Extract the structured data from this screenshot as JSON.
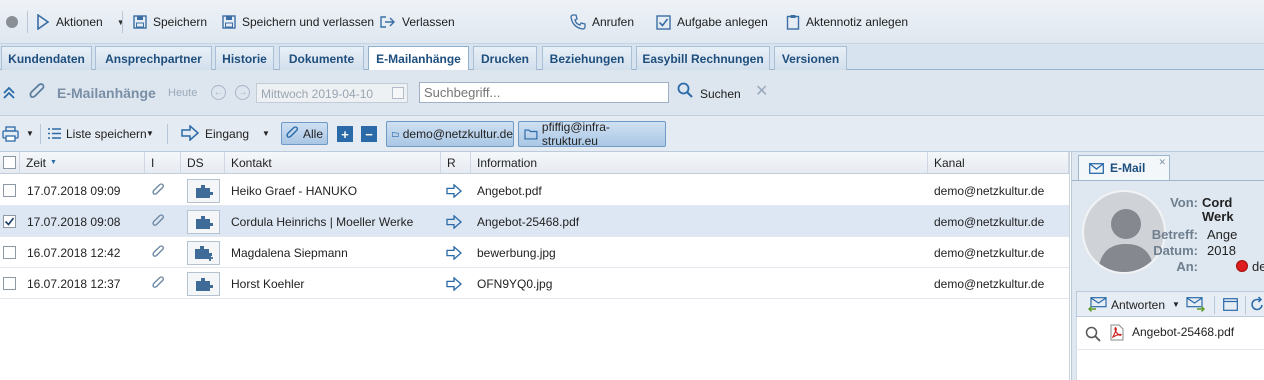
{
  "toolbar": {
    "actions_label": "Aktionen",
    "save_label": "Speichern",
    "save_close_label": "Speichern und verlassen",
    "leave_label": "Verlassen",
    "call_label": "Anrufen",
    "task_label": "Aufgabe anlegen",
    "note_label": "Aktennotiz anlegen"
  },
  "tabs": [
    {
      "label": "Kundendaten"
    },
    {
      "label": "Ansprechpartner"
    },
    {
      "label": "Historie"
    },
    {
      "label": "Dokumente"
    },
    {
      "label": "E-Mailanhänge",
      "active": true
    },
    {
      "label": "Drucken"
    },
    {
      "label": "Beziehungen"
    },
    {
      "label": "Easybill Rechnungen"
    },
    {
      "label": "Versionen"
    }
  ],
  "filter": {
    "title": "E-Mailanhänge",
    "today_label": "Heute",
    "date_value": "Mittwoch 2019-04-10",
    "search_placeholder": "Suchbegriff...",
    "search_label": "Suchen"
  },
  "listbar": {
    "save_list_label": "Liste speichern",
    "inbox_label": "Eingang",
    "all_label": "Alle",
    "mailbox_1": "demo@netzkultur.de",
    "mailbox_2": "pfiffig@infra-struktur.eu"
  },
  "grid": {
    "columns": {
      "zeit": "Zeit",
      "i": "I",
      "ds": "DS",
      "kontakt": "Kontakt",
      "r": "R",
      "information": "Information",
      "kanal": "Kanal"
    },
    "rows": [
      {
        "zeit": "17.07.2018 09:09",
        "kontakt": "Heiko Graef - HANUKO",
        "information": "Angebot.pdf",
        "kanal": "demo@netzkultur.de",
        "checked": false,
        "selected": false
      },
      {
        "zeit": "17.07.2018 09:08",
        "kontakt": "Cordula Heinrichs | Moeller Werke",
        "information": "Angebot-25468.pdf",
        "kanal": "demo@netzkultur.de",
        "checked": true,
        "selected": true
      },
      {
        "zeit": "16.07.2018 12:42",
        "kontakt": "Magdalena Siepmann",
        "information": "bewerbung.jpg",
        "kanal": "demo@netzkultur.de",
        "checked": false,
        "selected": false
      },
      {
        "zeit": "16.07.2018 12:37",
        "kontakt": "Horst Koehler",
        "information": "OFN9YQ0.jpg",
        "kanal": "demo@netzkultur.de",
        "checked": false,
        "selected": false
      }
    ]
  },
  "email_panel": {
    "tab_label": "E-Mail",
    "von_label": "Von:",
    "von_value_1": "Cord",
    "von_value_2": "Werk",
    "betreff_label": "Betreff:",
    "betreff_value": "Ange",
    "datum_label": "Datum:",
    "datum_value": "2018",
    "an_label": "An:",
    "an_value": "de",
    "reply_label": "Antworten",
    "attachment_name": "Angebot-25468.pdf"
  },
  "colors": {
    "accent": "#2b6aa8",
    "tab_text": "#1e4e7d",
    "selected_row": "#dde7f3",
    "status_red": "#e01b1b"
  }
}
